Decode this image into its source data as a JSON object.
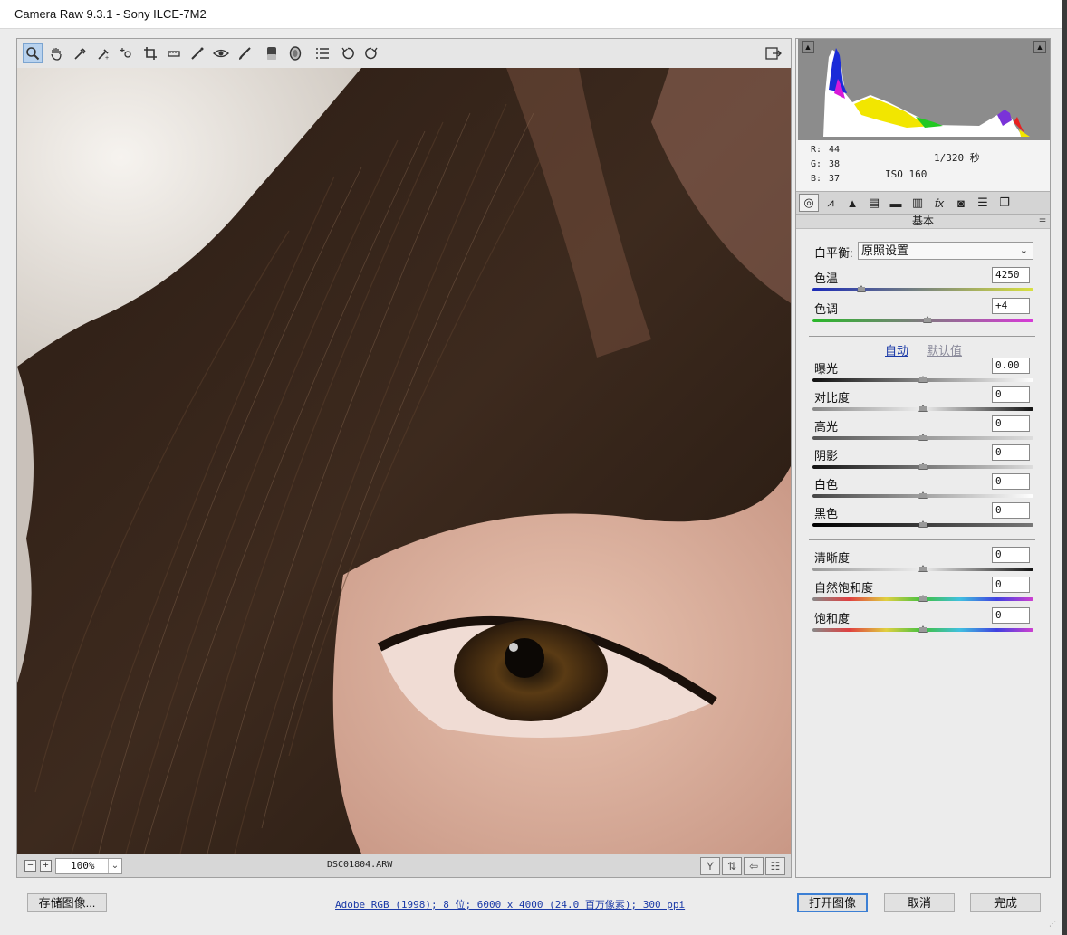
{
  "window": {
    "title": "Camera Raw 9.3.1 -  Sony ILCE-7M2"
  },
  "toolbar": {
    "tools": [
      {
        "name": "zoom-tool-icon",
        "glyph": "🔍"
      },
      {
        "name": "hand-tool-icon",
        "glyph": "✋"
      },
      {
        "name": "white-balance-tool-icon",
        "glyph": "⟋"
      },
      {
        "name": "color-sampler-tool-icon",
        "glyph": "⟋"
      },
      {
        "name": "targeted-adjustment-tool-icon",
        "glyph": "⊕"
      },
      {
        "name": "crop-tool-icon",
        "glyph": "⌗"
      },
      {
        "name": "straighten-tool-icon",
        "glyph": "▭"
      },
      {
        "name": "spot-removal-tool-icon",
        "glyph": "✎"
      },
      {
        "name": "red-eye-tool-icon",
        "glyph": "◉"
      },
      {
        "name": "adjustment-brush-icon",
        "glyph": "✏"
      },
      {
        "name": "graduated-filter-icon",
        "glyph": "▮"
      },
      {
        "name": "radial-filter-icon",
        "glyph": "◯"
      },
      {
        "name": "preferences-icon",
        "glyph": "☰"
      },
      {
        "name": "rotate-left-icon",
        "glyph": "↺"
      },
      {
        "name": "rotate-right-icon",
        "glyph": "↻"
      }
    ]
  },
  "status": {
    "zoom": "100%",
    "filename": "DSC01804.ARW"
  },
  "info": {
    "r_label": "R:",
    "r": "44",
    "g_label": "G:",
    "g": "38",
    "b_label": "B:",
    "b": "37",
    "shutter": "1/320 秒",
    "iso": "ISO 160"
  },
  "panel": {
    "title": "基本",
    "white_balance_label": "白平衡:",
    "white_balance_value": "原照设置",
    "auto_link": "自动",
    "default_link": "默认值",
    "sliders": [
      {
        "label": "色温",
        "value": "4250",
        "position": 0.22
      },
      {
        "label": "色调",
        "value": "+4",
        "position": 0.52
      },
      {
        "label": "曝光",
        "value": "0.00",
        "position": 0.5
      },
      {
        "label": "对比度",
        "value": "0",
        "position": 0.5
      },
      {
        "label": "高光",
        "value": "0",
        "position": 0.5
      },
      {
        "label": "阴影",
        "value": "0",
        "position": 0.5
      },
      {
        "label": "白色",
        "value": "0",
        "position": 0.5
      },
      {
        "label": "黑色",
        "value": "0",
        "position": 0.5
      },
      {
        "label": "清晰度",
        "value": "0",
        "position": 0.5
      },
      {
        "label": "自然饱和度",
        "value": "0",
        "position": 0.5
      },
      {
        "label": "饱和度",
        "value": "0",
        "position": 0.5
      }
    ]
  },
  "footer": {
    "save_button": "存储图像...",
    "workflow_link": "Adobe RGB (1998); 8 位; 6000 x 4000 (24.0 百万像素); 300 ppi",
    "open_button": "打开图像",
    "cancel_button": "取消",
    "done_button": "完成"
  },
  "colors": {
    "accent": "#3c7fd4",
    "link": "#1b3aa7",
    "histogram_bg": "#8c8c8c"
  }
}
